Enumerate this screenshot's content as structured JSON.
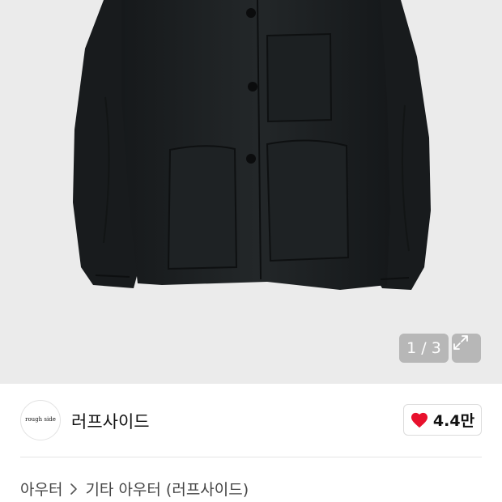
{
  "gallery": {
    "counter": "1 / 3",
    "expand_icon": "expand-icon",
    "background": "#ebebeb"
  },
  "brand": {
    "logo_text": "rough side",
    "logo_subtext": "",
    "name": "러프사이드"
  },
  "likes": {
    "count": "4.4만",
    "icon": "heart-icon",
    "icon_color": "#e8112d"
  },
  "breadcrumb": {
    "items": [
      "아우터",
      "기타 아우터 (러프사이드)"
    ],
    "separator_icon": "chevron-right-icon"
  }
}
